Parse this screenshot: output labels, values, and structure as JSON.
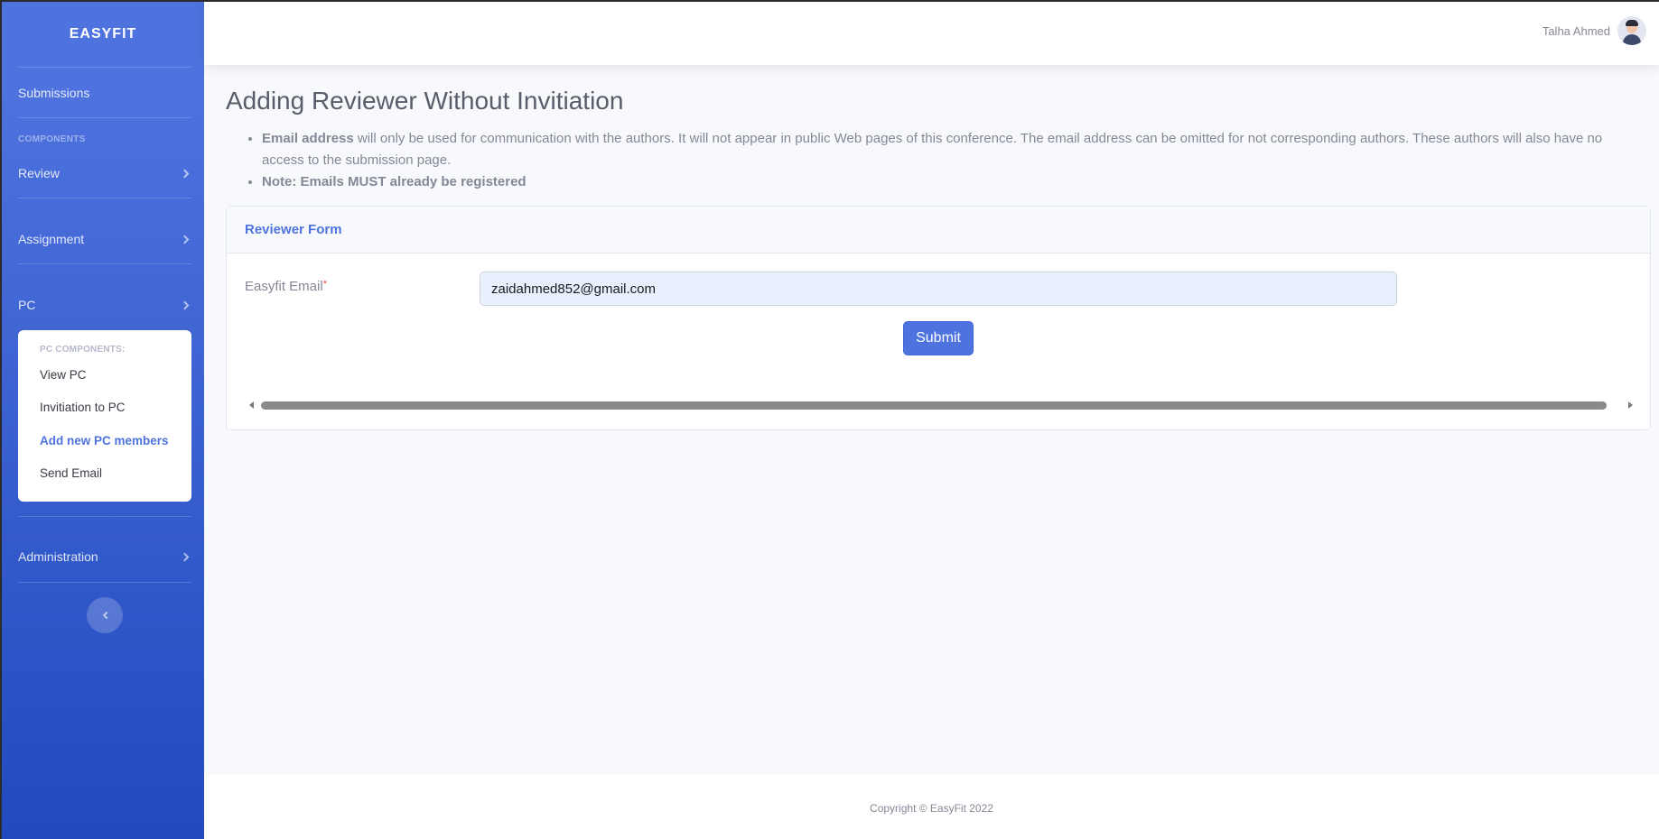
{
  "brand": "EASYFIT",
  "sidebar": {
    "submissions": "Submissions",
    "components_heading": "COMPONENTS",
    "items": [
      {
        "label": "Review"
      },
      {
        "label": "Assignment"
      },
      {
        "label": "PC"
      },
      {
        "label": "Administration"
      }
    ],
    "pc_submenu": {
      "heading": "PC COMPONENTS:",
      "items": [
        {
          "label": "View PC"
        },
        {
          "label": "Invitiation to PC"
        },
        {
          "label": "Add new PC members"
        },
        {
          "label": "Send Email"
        }
      ]
    }
  },
  "topbar": {
    "user_name": "Talha Ahmed"
  },
  "page": {
    "title": "Adding Reviewer Without Invitiation",
    "note1_bold": "Email address",
    "note1_text": " will only be used for communication with the authors. It will not appear in public Web pages of this conference. The email address can be omitted for not corresponding authors. These authors will also have no access to the submission page.",
    "note2": "Note: Emails MUST already be registered"
  },
  "form": {
    "header": "Reviewer Form",
    "email_label": "Easyfit Email",
    "required_mark": "*",
    "email_value": "zaidahmed852@gmail.com",
    "submit_label": "Submit"
  },
  "footer": {
    "copyright": "Copyright © EasyFit 2022"
  },
  "colors": {
    "primary": "#4e73df",
    "sidebar_gradient_end": "#224abe",
    "background": "#f8f9fc"
  }
}
